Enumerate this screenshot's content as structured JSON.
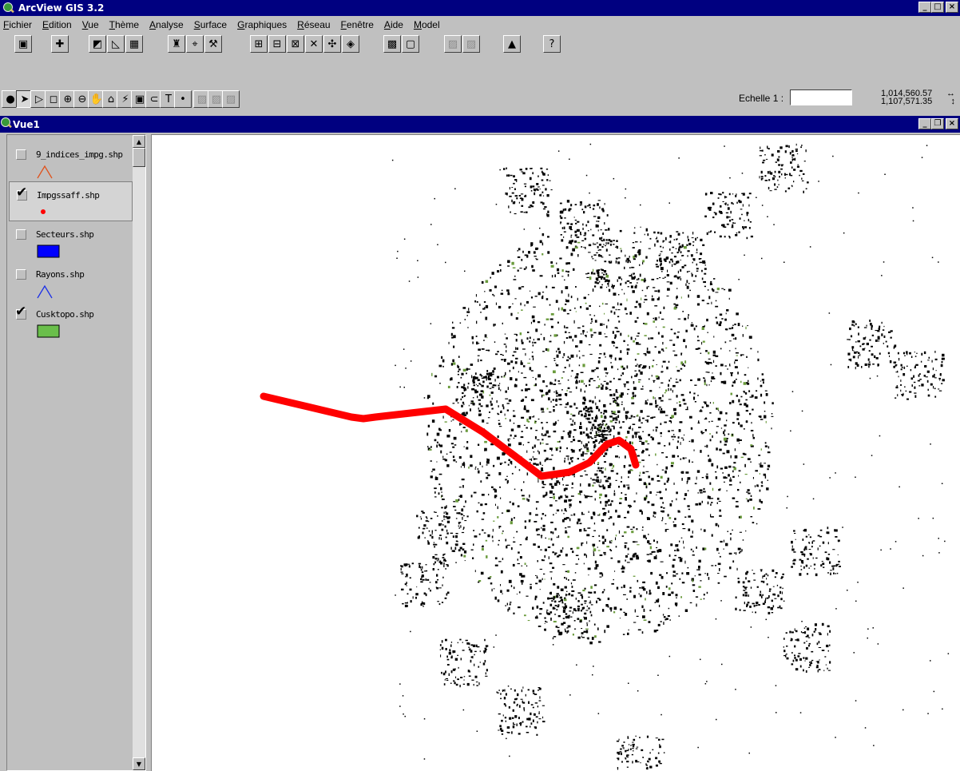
{
  "app": {
    "title": "ArcView GIS 3.2",
    "window_buttons": [
      "minimize",
      "restore",
      "close"
    ]
  },
  "menu": [
    "Fichier",
    "Edition",
    "Vue",
    "Thème",
    "Analyse",
    "Surface",
    "Graphiques",
    "Réseau",
    "Fenêtre",
    "Aide",
    "Model"
  ],
  "toolbar1": [
    {
      "name": "save-project-button",
      "icon": "floppy-disk-icon"
    },
    {
      "name": "add-theme-button",
      "icon": "add-theme-icon"
    },
    {
      "name": "theme-properties-button",
      "icon": "theme-properties-icon"
    },
    {
      "name": "edit-legend-button",
      "icon": "legend-icon"
    },
    {
      "name": "open-table-button",
      "icon": "table-icon"
    },
    {
      "name": "find-button",
      "icon": "binoculars-icon"
    },
    {
      "name": "locate-address-button",
      "icon": "locate-icon"
    },
    {
      "name": "query-builder-button",
      "icon": "hammer-icon"
    },
    {
      "name": "zoom-full-extent-button",
      "icon": "zoom-extent-icon"
    },
    {
      "name": "zoom-active-themes-button",
      "icon": "zoom-themes-icon"
    },
    {
      "name": "zoom-selected-button",
      "icon": "zoom-selected-icon"
    },
    {
      "name": "zoom-in-fixed-button",
      "icon": "zoom-in-fixed-icon"
    },
    {
      "name": "zoom-out-fixed-button",
      "icon": "zoom-out-fixed-icon"
    },
    {
      "name": "zoom-previous-button",
      "icon": "zoom-previous-icon"
    },
    {
      "name": "select-by-theme-button",
      "icon": "select-theme-icon"
    },
    {
      "name": "clear-selection-button",
      "icon": "clear-selection-icon"
    },
    {
      "name": "disabled-button-1",
      "icon": "disabled-icon"
    },
    {
      "name": "disabled-button-2",
      "icon": "disabled-icon"
    },
    {
      "name": "layout-button",
      "icon": "layout-icon"
    },
    {
      "name": "help-button",
      "icon": "help-icon"
    }
  ],
  "toolbar2": [
    {
      "name": "identify-tool",
      "icon": "identify-icon"
    },
    {
      "name": "pointer-tool",
      "icon": "pointer-icon"
    },
    {
      "name": "vertex-edit-tool",
      "icon": "vertex-edit-icon"
    },
    {
      "name": "select-feature-tool",
      "icon": "select-feature-icon"
    },
    {
      "name": "zoom-in-tool",
      "icon": "zoom-in-icon"
    },
    {
      "name": "zoom-out-tool",
      "icon": "zoom-out-icon"
    },
    {
      "name": "pan-tool",
      "icon": "hand-icon"
    },
    {
      "name": "measure-tool",
      "icon": "measure-icon"
    },
    {
      "name": "hotlink-tool",
      "icon": "hotlink-icon"
    },
    {
      "name": "area-of-interest-tool",
      "icon": "aoi-icon"
    },
    {
      "name": "label-tool",
      "icon": "label-icon"
    },
    {
      "name": "text-tool",
      "icon": "text-icon"
    },
    {
      "name": "draw-point-tool",
      "icon": "draw-point-icon"
    },
    {
      "name": "snap-tool-1",
      "icon": "disabled-icon"
    },
    {
      "name": "snap-tool-2",
      "icon": "disabled-icon"
    },
    {
      "name": "snap-tool-3",
      "icon": "disabled-icon"
    }
  ],
  "scale": {
    "label": "Echelle 1 :",
    "value": ""
  },
  "coords": {
    "x": "1,014,560.57",
    "y": "1,107,571.35"
  },
  "view": {
    "title": "Vue1"
  },
  "layers": [
    {
      "name": "9_indices_impg.shp",
      "visible": false,
      "symbol": "line",
      "color": "#e0521c"
    },
    {
      "name": "Impgssaff.shp",
      "visible": true,
      "symbol": "point",
      "color": "#ff0000"
    },
    {
      "name": "Secteurs.shp",
      "visible": false,
      "symbol": "fill",
      "color": "#0000ff"
    },
    {
      "name": "Rayons.shp",
      "visible": false,
      "symbol": "line",
      "color": "#1c30e8"
    },
    {
      "name": "Cusktopo.shp",
      "visible": true,
      "symbol": "fill",
      "color": "#6abf4b"
    }
  ],
  "map_colors": {
    "features": "#000000",
    "feature_fill": "#6a9b3c",
    "route": "#ff0000",
    "background": "#ffffff"
  }
}
